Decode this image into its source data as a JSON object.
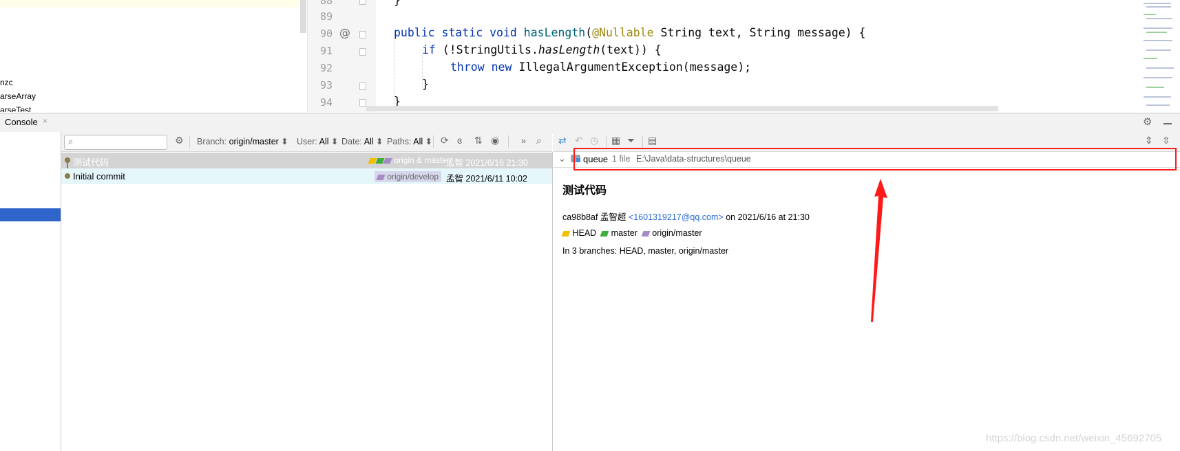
{
  "project_tree": {
    "items": [
      {
        "label": "nzc"
      },
      {
        "label": "arseArray"
      },
      {
        "label": "arseTest"
      }
    ]
  },
  "editor": {
    "line_numbers": [
      "88",
      "89",
      "90",
      "91",
      "92",
      "93",
      "94"
    ],
    "at_marker": "@",
    "lines": {
      "l88": "}",
      "l90_kw1": "public",
      "l90_kw2": "static",
      "l90_kw3": "void",
      "l90_fn": "hasLength",
      "l90_ann": "@Nullable",
      "l90_rest": "String text, String message) {",
      "l90_paren": "(",
      "l91_kw": "if",
      "l91_a": "(!StringUtils.",
      "l91_it": "hasLength",
      "l91_b": "(text)) {",
      "l92_kw1": "throw",
      "l92_kw2": "new",
      "l92_rest": "IllegalArgumentException(message);",
      "l93": "}",
      "l94": "}"
    }
  },
  "tool_window": {
    "tab_label": "Console",
    "close_glyph": "×",
    "gear_icon": "gear-icon",
    "minimize_icon": "minimize-icon"
  },
  "log_toolbar": {
    "search_placeholder": "",
    "branch_label": "Branch:",
    "branch_value": "origin/master",
    "user_label": "User:",
    "user_value": "All",
    "date_label": "Date:",
    "date_value": "All",
    "paths_label": "Paths:",
    "paths_value": "All",
    "more": "»"
  },
  "commits": [
    {
      "message": "测试代码",
      "refs": "origin & master",
      "author": "孟智",
      "date": "2021/6/16 21:30"
    },
    {
      "message": "Initial commit",
      "refs": "origin/develop",
      "author": "孟智",
      "date": "2021/6/11 10:02"
    }
  ],
  "details": {
    "changes": {
      "folder": "queue",
      "count": "1 file",
      "path": "E:\\Java\\data-structures\\queue"
    },
    "title": "测试代码",
    "hash": "ca98b8af",
    "author": "孟智超",
    "email": "<1601319217@qq.com>",
    "on_text": "on 2021/6/16 at 21:30",
    "refs": [
      "HEAD",
      "master",
      "origin/master"
    ],
    "branches_text": "In 3 branches: HEAD, master, origin/master"
  },
  "colors": {
    "selection": "#2f65ca",
    "annotation_red": "#ff1a1a",
    "tag_yellow": "#f0c000",
    "tag_green": "#3fae3f",
    "tag_purple": "#a78bc7"
  },
  "watermark": "https://blog.csdn.net/weixin_45692705"
}
